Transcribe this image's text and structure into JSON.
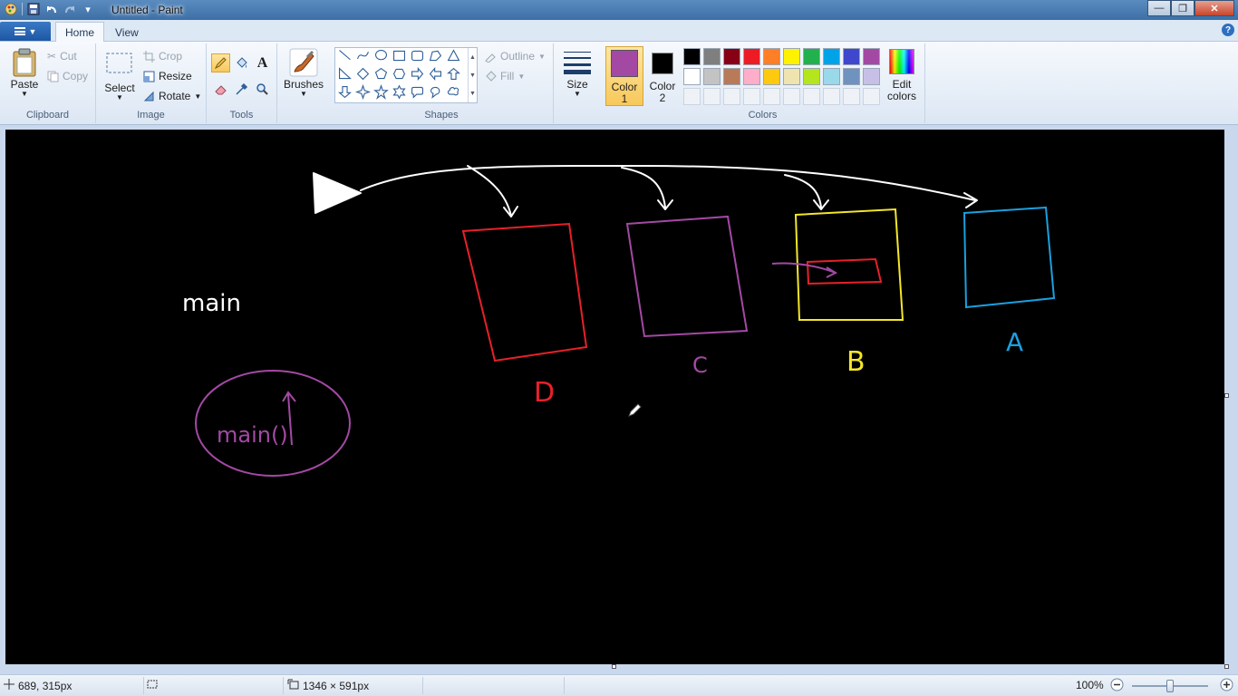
{
  "window": {
    "title": "Untitled - Paint",
    "controls": {
      "minimize": "—",
      "maximize": "❐",
      "close": "✕"
    }
  },
  "quick_access": {
    "save_icon": "save-icon",
    "undo_icon": "undo-icon",
    "redo_icon": "redo-icon",
    "customize_icon": "dropdown-icon"
  },
  "tabs": [
    {
      "label": "Home",
      "active": true
    },
    {
      "label": "View",
      "active": false
    }
  ],
  "help": "?",
  "ribbon": {
    "clipboard": {
      "label": "Clipboard",
      "paste": "Paste",
      "cut": "Cut",
      "copy": "Copy"
    },
    "image": {
      "label": "Image",
      "select": "Select",
      "crop": "Crop",
      "resize": "Resize",
      "rotate": "Rotate"
    },
    "tools": {
      "label": "Tools",
      "active_tool": "pencil"
    },
    "brushes": {
      "label": "Brushes"
    },
    "shapes": {
      "label": "Shapes",
      "outline": "Outline",
      "fill": "Fill"
    },
    "size": {
      "label": "Size"
    },
    "colors": {
      "label": "Colors",
      "color1_label": "Color",
      "color1_num": "1",
      "color2_label": "Color",
      "color2_num": "2",
      "color1": "#a349a4",
      "color2": "#000000",
      "edit_label": "Edit",
      "edit_label2": "colors",
      "palette_row1": [
        "#000000",
        "#7f7f7f",
        "#880015",
        "#ed1c24",
        "#ff7f27",
        "#fff200",
        "#22b14c",
        "#00a2e8",
        "#3f48cc",
        "#a349a4"
      ],
      "palette_row2": [
        "#ffffff",
        "#c3c3c3",
        "#b97a57",
        "#ffaec9",
        "#ffc90e",
        "#efe4b0",
        "#b5e61d",
        "#99d9ea",
        "#7092be",
        "#c8bfe7"
      ],
      "palette_empty_count": 10
    }
  },
  "drawing": {
    "labels": {
      "main": "main",
      "main_call": "main()",
      "box_d": "D",
      "box_c": "C",
      "box_b": "B",
      "box_a": "A"
    },
    "colors": {
      "white": "#ffffff",
      "red": "#e8202a",
      "purple": "#a349a4",
      "yellow": "#f5e62a",
      "blue": "#1aa0e0"
    }
  },
  "status": {
    "cursor_pos": "689, 315px",
    "canvas_size": "1346 × 591px",
    "zoom": "100%"
  }
}
